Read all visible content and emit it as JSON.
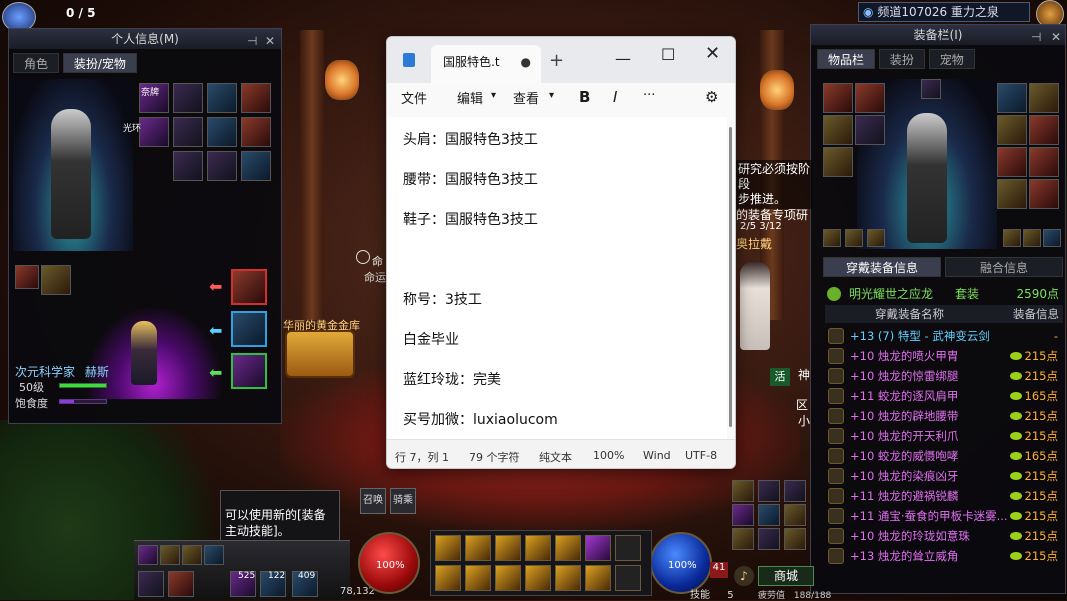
{
  "hud": {
    "counter": "0 / 5",
    "exp": "78,132"
  },
  "channel": {
    "label": "频道107026 重力之泉"
  },
  "profile": {
    "title": "个人信息(M)",
    "tabs": [
      "角色",
      "装扮/宠物"
    ],
    "slot_labels": [
      "奈牌",
      "光环"
    ],
    "class_name": "次元科学家",
    "char_name": "赫斯",
    "level": "50级",
    "fatigue_label": "饱食度"
  },
  "notepad": {
    "tab_title": "国服特色.t",
    "menus": [
      "文件",
      "编辑",
      "查看"
    ],
    "lines": [
      "头肩：国服特色3技工",
      "腰带：国服特色3技工",
      "鞋子：国服特色3技工",
      "称号：3技工",
      "白金毕业",
      "蓝红玲珑：完美",
      "买号加微：luxiaolucom"
    ],
    "status": {
      "pos": "行 7，列 1",
      "chars": "79 个字符",
      "mode": "纯文本",
      "zoom": "100%",
      "eol": "Wind",
      "enc": "UTF-8"
    }
  },
  "equip": {
    "title": "装备栏(I)",
    "tabs": [
      "物品栏",
      "装扮",
      "宠物"
    ],
    "info_tabs": [
      "穿戴装备信息",
      "融合信息"
    ],
    "set_name": "明光耀世之应龙",
    "set_label": "套装",
    "set_points": "2590点",
    "col_name": "穿戴装备名称",
    "col_info": "装备信息",
    "items": [
      {
        "name": "+13 (7) 特型 - 武神变云剑",
        "pts": "-",
        "color": "#60d0ff"
      },
      {
        "name": "+10 烛龙的喷火甲胄",
        "pts": "215点",
        "color": "#e070f0"
      },
      {
        "name": "+10 烛龙的惊雷绑腿",
        "pts": "215点",
        "color": "#e070f0"
      },
      {
        "name": "+11 蛟龙的逐风肩甲",
        "pts": "165点",
        "color": "#e070f0"
      },
      {
        "name": "+10 烛龙的辟地腰带",
        "pts": "215点",
        "color": "#e070f0"
      },
      {
        "name": "+10 烛龙的开天利爪",
        "pts": "215点",
        "color": "#e070f0"
      },
      {
        "name": "+10 蛟龙的威慑咆哮",
        "pts": "165点",
        "color": "#e070f0"
      },
      {
        "name": "+10 烛龙的染痕凶牙",
        "pts": "215点",
        "color": "#e070f0"
      },
      {
        "name": "+11 烛龙的避祸锐麟",
        "pts": "215点",
        "color": "#e070f0"
      },
      {
        "name": "+11 通宝·蚕食的甲板卡迷雾...",
        "pts": "215点",
        "color": "#e070f0"
      },
      {
        "name": "+10 烛龙的玲珑如意珠",
        "pts": "215点",
        "color": "#e070f0"
      },
      {
        "name": "+13 烛龙的耸立威角",
        "pts": "215点",
        "color": "#e070f0"
      }
    ]
  },
  "world": {
    "quest_text": [
      "研究必须按阶段",
      "步推进。"
    ],
    "quest2": "的装备专项研",
    "quest_progress": "2/5 3/12",
    "npc": "奥拉戴",
    "vault": "华丽的黄金金库",
    "mark": "命",
    "mark2": "命运",
    "right_labels": [
      "神",
      "活",
      "区",
      "小"
    ],
    "tooltip": "可以使用新的[装备主动技能]。",
    "btn_a": "召唤",
    "btn_b": "骑乘",
    "hp": "100%",
    "mp": "100%",
    "mp_num": "41",
    "ex_label": "技能",
    "ex_num": "5",
    "market": "商城",
    "fatigue_bottom": "疲劳值",
    "fatigue_val": "188/188",
    "item_counts": [
      "525",
      "122",
      "409"
    ]
  }
}
